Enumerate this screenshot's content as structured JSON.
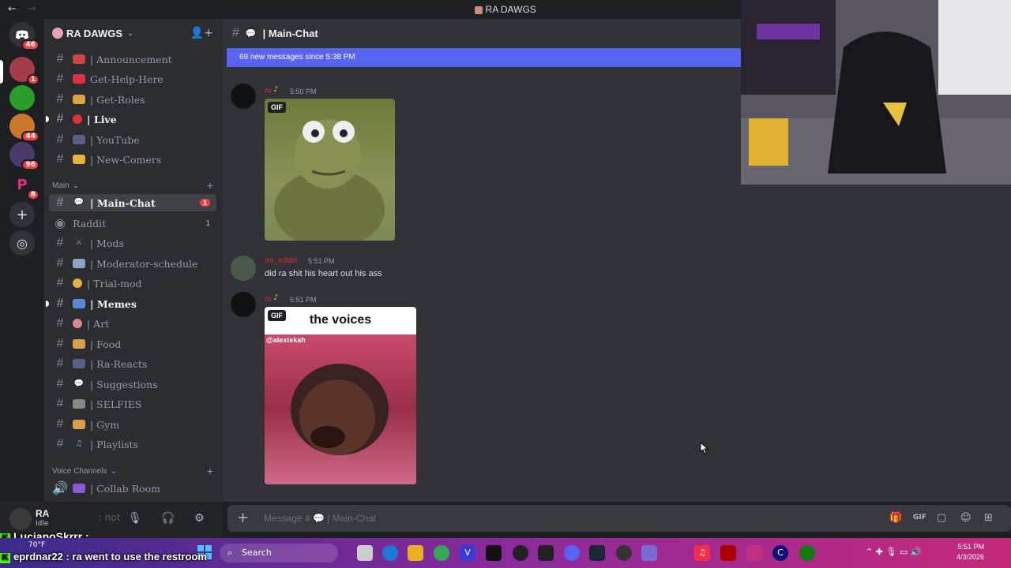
{
  "window": {
    "title": "RA DAWGS",
    "nav_back": "←",
    "nav_forward": "→"
  },
  "servers": [
    {
      "badge": "46"
    },
    {
      "badge": "1"
    },
    {
      "badge": ""
    },
    {
      "badge": "44"
    },
    {
      "badge": "96"
    },
    {
      "badge": "8"
    }
  ],
  "guild": {
    "name": "RA DAWGS"
  },
  "channels": [
    {
      "label": "| Announcement"
    },
    {
      "label": "Get-Help-Here"
    },
    {
      "label": "| Get-Roles"
    },
    {
      "label": "| Live"
    },
    {
      "label": "| YouTube"
    },
    {
      "label": "| New-Comers"
    }
  ],
  "category_main": {
    "label": "Main"
  },
  "channels_main": [
    {
      "label": "| Main-Chat",
      "count": "1"
    },
    {
      "label": "Raddit",
      "count": "1"
    },
    {
      "label": "| Mods"
    },
    {
      "label": "| Moderator-schedule"
    },
    {
      "label": "| Trial-mod"
    },
    {
      "label": "| Memes"
    },
    {
      "label": "| Art"
    },
    {
      "label": "| Food"
    },
    {
      "label": "| Ra-Reacts"
    },
    {
      "label": "| Suggestions"
    },
    {
      "label": "| SELFIES"
    },
    {
      "label": "| Gym"
    },
    {
      "label": "| Playlists"
    }
  ],
  "category_voice": {
    "label": "Voice Channels"
  },
  "voice_channels": [
    {
      "label": "| Collab Room"
    }
  ],
  "user": {
    "name": "RA",
    "status": "Idle",
    "faded": ": not"
  },
  "chat": {
    "channel_name": "| Main-Chat",
    "new_messages": "69 new messages since 5:38 PM",
    "messages": [
      {
        "author": "m",
        "time": "5:50 PM",
        "gif_label": "GIF"
      },
      {
        "author": "mr_eddie",
        "time": "5:51 PM",
        "text": "did ra shit his heart out his ass"
      },
      {
        "author": "m",
        "time": "5:51 PM",
        "gif_label": "GIF",
        "gif_caption": "the voices",
        "gif_handle": "@alextekah"
      }
    ]
  },
  "composer": {
    "placeholder": "Message #",
    "channel": "| Main-Chat"
  },
  "overlay": {
    "line1": "LucianoSkrrr :",
    "line2": "eprdnar22 : ra went to use the restroom"
  },
  "taskbar": {
    "weather": "70°F",
    "search": "Search",
    "time": "5:51 PM",
    "date": "4/3/2026"
  },
  "colors": {
    "accent": "#5865f2",
    "badge": "#f23f43",
    "bg": "#313338"
  }
}
